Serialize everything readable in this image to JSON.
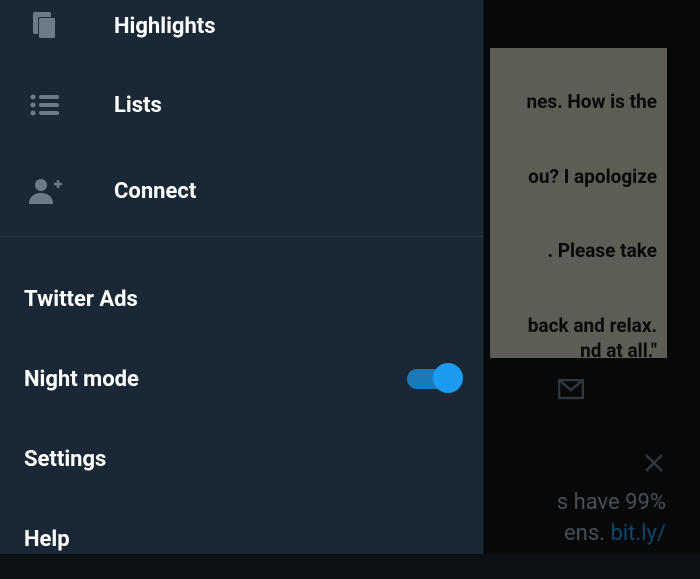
{
  "drawer": {
    "primary": [
      {
        "icon": "highlights",
        "label": "Highlights"
      },
      {
        "icon": "lists",
        "label": "Lists"
      },
      {
        "icon": "connect",
        "label": "Connect"
      }
    ],
    "secondary": {
      "ads": "Twitter Ads",
      "night_mode": "Night mode",
      "night_mode_on": true,
      "settings": "Settings",
      "help": "Help"
    }
  },
  "background": {
    "card": {
      "line1": "nes. How is the",
      "line2": "ou? I apologize",
      "line3": ". Please take",
      "line4a": "back and relax.",
      "line4b": "nd at all.\""
    },
    "text_line1": "s have 99%",
    "text_line2_prefix": "ens.  ",
    "text_line2_link": "bit.ly/"
  }
}
